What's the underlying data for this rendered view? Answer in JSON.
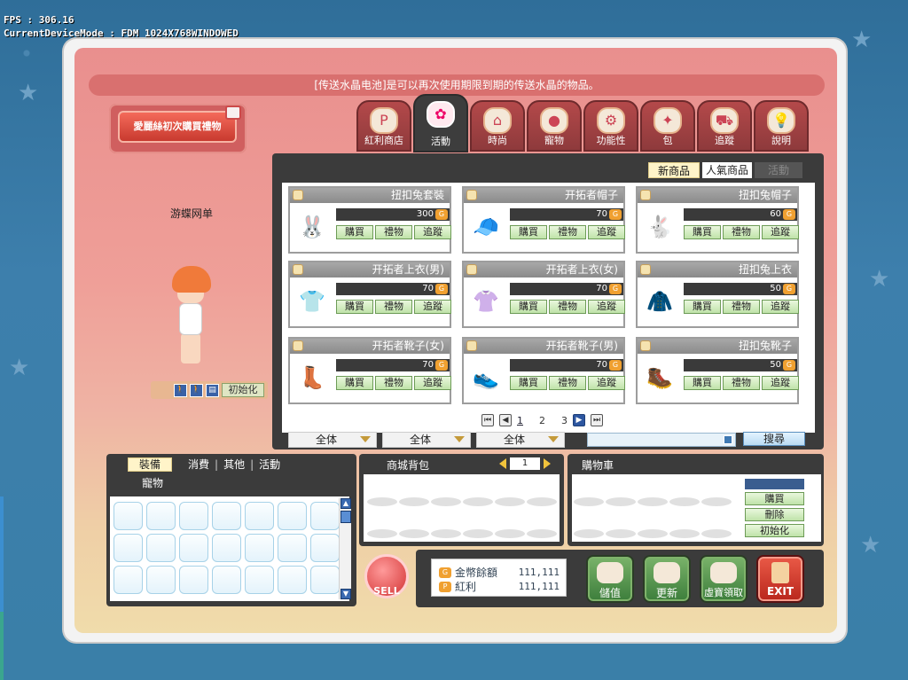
{
  "debug": {
    "fps": "FPS : 306.16",
    "device": "CurrentDeviceMode : FDM_1024X768WINDOWED"
  },
  "banner": "[传送水晶电池]是可以再次使用期限到期的传送水晶的物品。",
  "gift_button": "愛麗絲初次購買禮物",
  "character": {
    "name": "游蝶网单",
    "init_label": "初始化"
  },
  "tabs": [
    {
      "label": "紅利商店",
      "icon": "bonus-p-icon"
    },
    {
      "label": "活動",
      "icon": "event-flower-icon",
      "active": true
    },
    {
      "label": "時尚",
      "icon": "fashion-hanger-icon"
    },
    {
      "label": "寵物",
      "icon": "pet-icon"
    },
    {
      "label": "功能性",
      "icon": "gear-icon"
    },
    {
      "label": "包",
      "icon": "package-icon"
    },
    {
      "label": "追蹤",
      "icon": "cart-icon"
    },
    {
      "label": "說明",
      "icon": "lightbulb-icon"
    }
  ],
  "filters": {
    "new": "新商品",
    "hot": "人氣商品",
    "event": "活動"
  },
  "items": [
    {
      "name": "扭扣兔套裝",
      "price": "300",
      "icon": "rabbit-outfit-icon"
    },
    {
      "name": "开拓者帽子",
      "price": "70",
      "icon": "pink-cap-icon"
    },
    {
      "name": "扭扣兔帽子",
      "price": "60",
      "icon": "rabbit-hat-icon"
    },
    {
      "name": "开拓者上衣(男)",
      "price": "70",
      "icon": "shirt-male-icon"
    },
    {
      "name": "开拓者上衣(女)",
      "price": "70",
      "icon": "shirt-female-icon"
    },
    {
      "name": "扭扣兔上衣",
      "price": "50",
      "icon": "rabbit-shirt-icon"
    },
    {
      "name": "开拓者靴子(女)",
      "price": "70",
      "icon": "boots-female-icon"
    },
    {
      "name": "开拓者靴子(男)",
      "price": "70",
      "icon": "boots-male-icon"
    },
    {
      "name": "扭扣兔靴子",
      "price": "50",
      "icon": "rabbit-boots-icon"
    }
  ],
  "item_buttons": {
    "buy": "購買",
    "gift": "禮物",
    "track": "追蹤"
  },
  "pagination": {
    "pages": [
      "1",
      "2",
      "3"
    ],
    "current": "1"
  },
  "dropdowns": [
    "全体",
    "全体",
    "全体"
  ],
  "search": {
    "button": "搜尋",
    "value": ""
  },
  "inventory": {
    "tabs": [
      "裝備",
      "消費",
      "其他",
      "活動"
    ],
    "tab2": "寵物",
    "active": "裝備"
  },
  "bag": {
    "title": "商城背包",
    "page": "1"
  },
  "cart": {
    "title": "購物車",
    "buttons": [
      "購買",
      "刪除",
      "初始化"
    ]
  },
  "sell_label": "SELL",
  "wallet": {
    "coins_label": "金幣餘額",
    "coins_value": "111,111",
    "bonus_label": "紅利",
    "bonus_value": "111,111"
  },
  "actions": [
    "儲值",
    "更新",
    "虛寶領取",
    "EXIT"
  ],
  "colors": {
    "shop_bg": "#3b3b3b",
    "accent_green": "#bfe3a9",
    "panel_pink": "#ef9f98"
  }
}
